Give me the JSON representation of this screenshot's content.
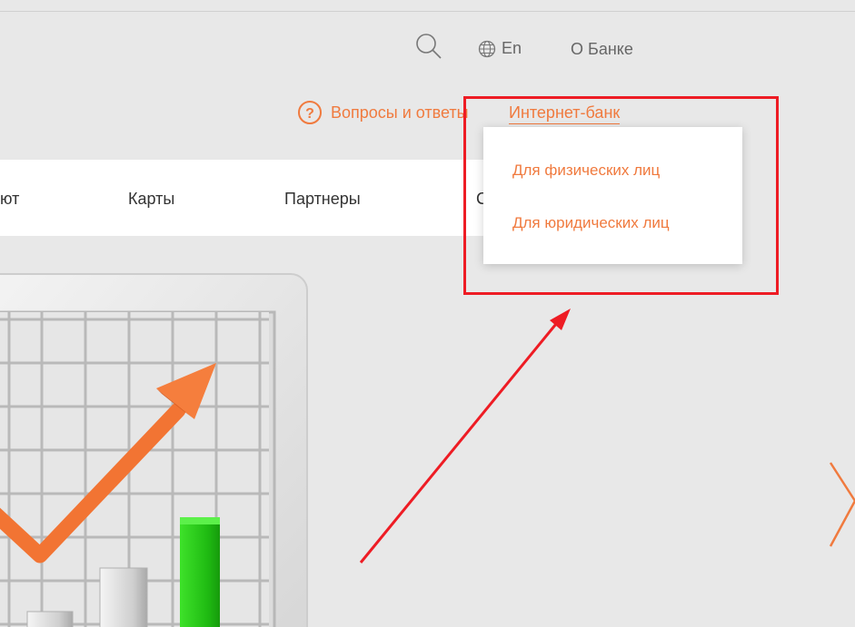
{
  "header": {
    "language_label": "En",
    "about_label": "О Банке",
    "faq_label": "Вопросы и ответы",
    "internet_bank_label": "Интернет-банк"
  },
  "nav": {
    "items": [
      "ют",
      "Карты",
      "Партнеры",
      "С"
    ]
  },
  "dropdown": {
    "items": [
      "Для физических лиц",
      "Для юридических лиц"
    ]
  },
  "colors": {
    "accent": "#f07a3e",
    "annotation": "#ee1c24",
    "chart_bar": "#2ecc1a",
    "background": "#e8e8e8"
  },
  "icons": [
    "search-icon",
    "globe-icon",
    "question-circle-icon",
    "chevron-right-icon"
  ]
}
